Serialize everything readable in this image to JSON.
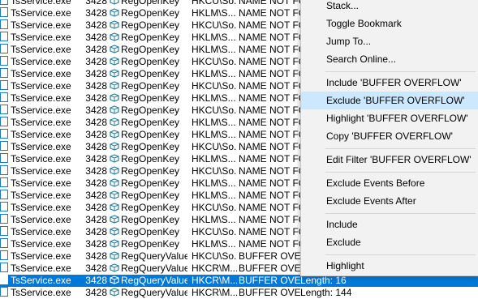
{
  "rows": [
    {
      "process": "TsService.exe",
      "pid": "3428",
      "operation": "RegOpenKey",
      "path": "HKCU\\So...",
      "result": "NAME NOT FOUND",
      "detail": ""
    },
    {
      "process": "TsService.exe",
      "pid": "3428",
      "operation": "RegOpenKey",
      "path": "HKLM\\S...",
      "result": "NAME NOT FOUND",
      "detail": ""
    },
    {
      "process": "TsService.exe",
      "pid": "3428",
      "operation": "RegOpenKey",
      "path": "HKCU\\So...",
      "result": "NAME NOT FOUND",
      "detail": ""
    },
    {
      "process": "TsService.exe",
      "pid": "3428",
      "operation": "RegOpenKey",
      "path": "HKLM\\S...",
      "result": "NAME NOT FOUND",
      "detail": ""
    },
    {
      "process": "TsService.exe",
      "pid": "3428",
      "operation": "RegOpenKey",
      "path": "HKLM\\S...",
      "result": "NAME NOT FOUND",
      "detail": ""
    },
    {
      "process": "TsService.exe",
      "pid": "3428",
      "operation": "RegOpenKey",
      "path": "HKCU\\So...",
      "result": "NAME NOT FOUND",
      "detail": ""
    },
    {
      "process": "TsService.exe",
      "pid": "3428",
      "operation": "RegOpenKey",
      "path": "HKLM\\S...",
      "result": "NAME NOT FOUND",
      "detail": ""
    },
    {
      "process": "TsService.exe",
      "pid": "3428",
      "operation": "RegOpenKey",
      "path": "HKCU\\So...",
      "result": "NAME NOT FOUND",
      "detail": ""
    },
    {
      "process": "TsService.exe",
      "pid": "3428",
      "operation": "RegOpenKey",
      "path": "HKLM\\S...",
      "result": "NAME NOT FOUND",
      "detail": ""
    },
    {
      "process": "TsService.exe",
      "pid": "3428",
      "operation": "RegOpenKey",
      "path": "HKCU\\So...",
      "result": "NAME NOT FOUND",
      "detail": ""
    },
    {
      "process": "TsService.exe",
      "pid": "3428",
      "operation": "RegOpenKey",
      "path": "HKLM\\S...",
      "result": "NAME NOT FOUND",
      "detail": ""
    },
    {
      "process": "TsService.exe",
      "pid": "3428",
      "operation": "RegOpenKey",
      "path": "HKLM\\S...",
      "result": "NAME NOT FOUND",
      "detail": ""
    },
    {
      "process": "TsService.exe",
      "pid": "3428",
      "operation": "RegOpenKey",
      "path": "HKCU\\So...",
      "result": "NAME NOT FOUND",
      "detail": ""
    },
    {
      "process": "TsService.exe",
      "pid": "3428",
      "operation": "RegOpenKey",
      "path": "HKLM\\S...",
      "result": "NAME NOT FOUND",
      "detail": ""
    },
    {
      "process": "TsService.exe",
      "pid": "3428",
      "operation": "RegOpenKey",
      "path": "HKCU\\So...",
      "result": "NAME NOT FOUND",
      "detail": ""
    },
    {
      "process": "TsService.exe",
      "pid": "3428",
      "operation": "RegOpenKey",
      "path": "HKLM\\S...",
      "result": "NAME NOT FOUND",
      "detail": ""
    },
    {
      "process": "TsService.exe",
      "pid": "3428",
      "operation": "RegOpenKey",
      "path": "HKLM\\S...",
      "result": "NAME NOT FOUND",
      "detail": ""
    },
    {
      "process": "TsService.exe",
      "pid": "3428",
      "operation": "RegOpenKey",
      "path": "HKCU\\So...",
      "result": "NAME NOT FOUND",
      "detail": ""
    },
    {
      "process": "TsService.exe",
      "pid": "3428",
      "operation": "RegOpenKey",
      "path": "HKLM\\S...",
      "result": "NAME NOT FOUND",
      "detail": ""
    },
    {
      "process": "TsService.exe",
      "pid": "3428",
      "operation": "RegOpenKey",
      "path": "HKCU\\So...",
      "result": "NAME NOT FOUND",
      "detail": ""
    },
    {
      "process": "TsService.exe",
      "pid": "3428",
      "operation": "RegOpenKey",
      "path": "HKLM\\S...",
      "result": "NAME NOT FOUND",
      "detail": ""
    },
    {
      "process": "TsService.exe",
      "pid": "3428",
      "operation": "RegQueryValue",
      "path": "HKCU\\So...",
      "result": "BUFFER OVERFLOW",
      "detail": ""
    },
    {
      "process": "TsService.exe",
      "pid": "3428",
      "operation": "RegQueryValue",
      "path": "HKCR\\M...",
      "result": "BUFFER OVERFLOW",
      "detail": ""
    },
    {
      "process": "TsService.exe",
      "pid": "3428",
      "operation": "RegQueryValue",
      "path": "HKCR\\M...",
      "result": "BUFFER OVERFL...",
      "detail": "Length: 16",
      "selected": true
    },
    {
      "process": "TsService.exe",
      "pid": "3428",
      "operation": "RegQueryValue",
      "path": "HKCR\\M...",
      "result": "BUFFER OVERFL...",
      "detail": "Length: 144"
    }
  ],
  "context_menu": {
    "items": [
      {
        "label": "Stack..."
      },
      {
        "label": "Toggle Bookmark"
      },
      {
        "label": "Jump To..."
      },
      {
        "label": "Search Online..."
      },
      {
        "separator": true
      },
      {
        "label": "Include 'BUFFER OVERFLOW'"
      },
      {
        "label": "Exclude 'BUFFER OVERFLOW'",
        "highlighted": true
      },
      {
        "label": "Highlight 'BUFFER OVERFLOW'"
      },
      {
        "label": "Copy 'BUFFER OVERFLOW'"
      },
      {
        "separator": true
      },
      {
        "label": "Edit Filter 'BUFFER OVERFLOW'"
      },
      {
        "separator": true
      },
      {
        "label": "Exclude Events Before"
      },
      {
        "label": "Exclude Events After"
      },
      {
        "separator": true
      },
      {
        "label": "Include"
      },
      {
        "label": "Exclude"
      },
      {
        "separator": true
      },
      {
        "label": "Highlight"
      }
    ]
  },
  "colors": {
    "selection": "#0078d7",
    "menu_hover": "#cce8ff",
    "menu_bg": "#f2f2f2",
    "registry_icon": "#2e7d9a"
  },
  "icons": {
    "process": "process-window-icon",
    "operation": "registry-cube-icon"
  }
}
